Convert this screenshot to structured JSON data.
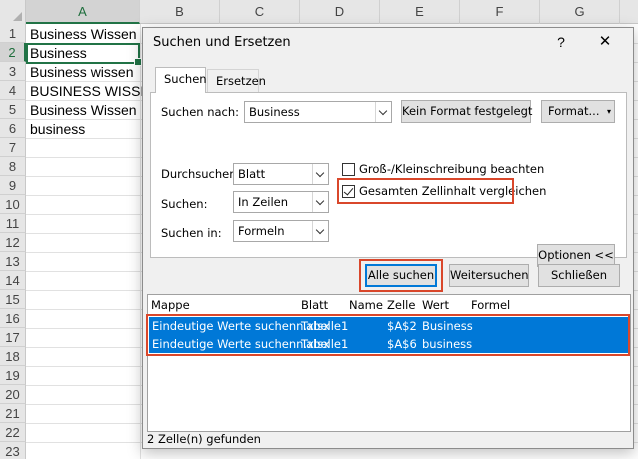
{
  "sheet": {
    "columns": [
      "A",
      "B",
      "C",
      "D",
      "E",
      "F",
      "G"
    ],
    "rows": [
      "1",
      "2",
      "3",
      "4",
      "5",
      "6",
      "7",
      "8",
      "9",
      "10",
      "11",
      "12",
      "13",
      "14",
      "15",
      "16",
      "17",
      "18",
      "19",
      "20",
      "21",
      "22",
      "23"
    ],
    "cells_a": [
      "Business Wissen",
      "Business",
      "Business wissen",
      "BUSINESS WISSEN",
      "Business Wissen",
      "business"
    ]
  },
  "dialog": {
    "title": "Suchen und Ersetzen",
    "help_glyph": "?",
    "close_glyph": "✕",
    "tabs": [
      {
        "label": "Suchen",
        "active": true
      },
      {
        "label": "Ersetzen",
        "active": false
      }
    ],
    "search": {
      "label": "Suchen nach:",
      "value": "Business",
      "format_status": "Kein Format festgelegt",
      "format_button": "Format...",
      "format_dropdown_glyph": "▾"
    },
    "options": {
      "within_label": "Durchsuchen:",
      "within_value": "Blatt",
      "search_label": "Suchen:",
      "search_value": "In Zeilen",
      "lookin_label": "Suchen in:",
      "lookin_value": "Formeln",
      "match_case_label": "Groß-/Kleinschreibung beachten",
      "match_case_checked": false,
      "match_entire_label": "Gesamten Zellinhalt vergleichen",
      "match_entire_checked": true,
      "options_button": "Optionen <<"
    },
    "buttons": {
      "find_all": "Alle suchen",
      "find_next": "Weitersuchen",
      "close": "Schließen"
    },
    "results": {
      "headers": [
        "Mappe",
        "Blatt",
        "Name",
        "Zelle",
        "Wert",
        "Formel"
      ],
      "rows": [
        {
          "mappe": "Eindeutige Werte suchenn.xlsx",
          "blatt": "Tabelle1",
          "name": "",
          "zelle": "$A$2",
          "wert": "Business",
          "formel": ""
        },
        {
          "mappe": "Eindeutige Werte suchenn.xlsx",
          "blatt": "Tabelle1",
          "name": "",
          "zelle": "$A$6",
          "wert": "business",
          "formel": ""
        }
      ]
    },
    "status": "2 Zelle(n) gefunden"
  },
  "colors": {
    "excel_green": "#217346",
    "highlight_red": "#d9472b",
    "selection_blue": "#0078d7"
  }
}
